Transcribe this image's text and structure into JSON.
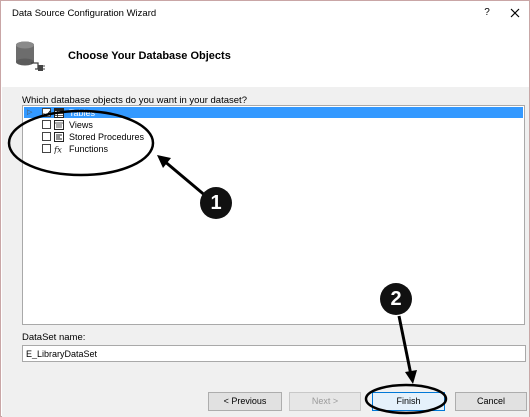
{
  "window": {
    "title": "Data Source Configuration Wizard",
    "help_label": "?"
  },
  "header": {
    "heading": "Choose Your Database Objects"
  },
  "objects": {
    "question": "Which database objects do you want in your dataset?",
    "items": [
      {
        "label": "Tables",
        "checked": true,
        "selected": true,
        "icon": "table-icon"
      },
      {
        "label": "Views",
        "checked": false,
        "selected": false,
        "icon": "view-icon"
      },
      {
        "label": "Stored Procedures",
        "checked": false,
        "selected": false,
        "icon": "stored-procedure-icon"
      },
      {
        "label": "Functions",
        "checked": false,
        "selected": false,
        "icon": "function-icon"
      }
    ]
  },
  "dataset": {
    "label": "DataSet name:",
    "value": "E_LibraryDataSet"
  },
  "buttons": {
    "previous": "< Previous",
    "next": "Next >",
    "finish": "Finish",
    "cancel": "Cancel"
  },
  "annotations": {
    "badge_1": "1",
    "badge_2": "2"
  },
  "colors": {
    "selection": "#3399ff",
    "annotation": "#000000"
  }
}
